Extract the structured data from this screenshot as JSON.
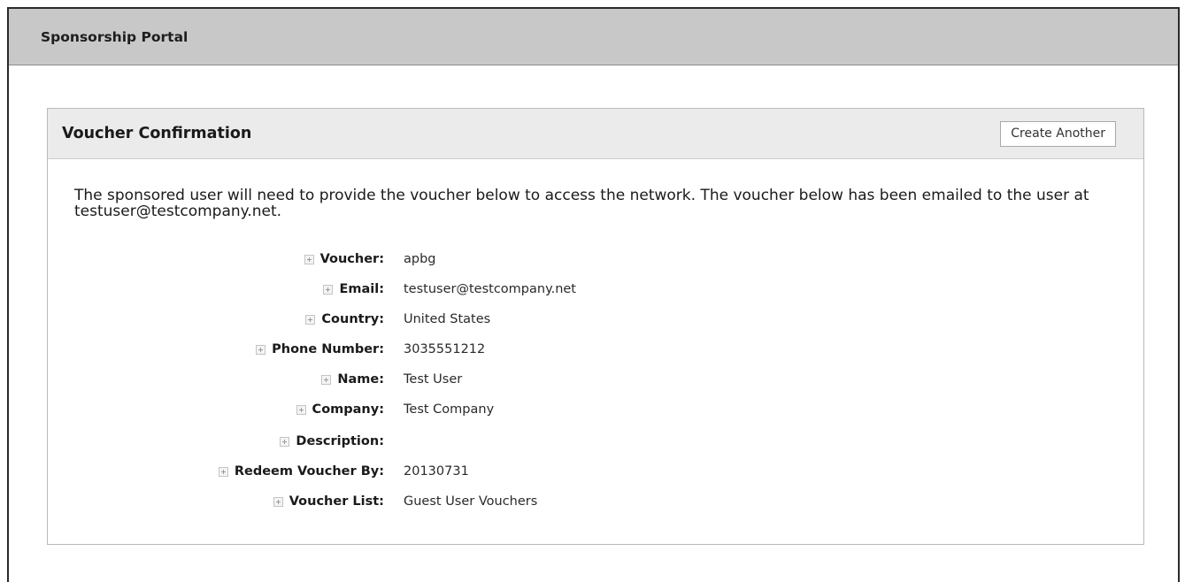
{
  "header": {
    "title": "Sponsorship Portal"
  },
  "panel": {
    "title": "Voucher Confirmation",
    "create_button_label": "Create Another",
    "intro_text": "The sponsored user will need to provide the voucher below to access the network. The voucher below has been emailed to the user at testuser@testcompany.net."
  },
  "fields": [
    {
      "label": "Voucher:",
      "value": "apbg"
    },
    {
      "label": "Email:",
      "value": "testuser@testcompany.net"
    },
    {
      "label": "Country:",
      "value": "United States"
    },
    {
      "label": "Phone Number:",
      "value": "3035551212"
    },
    {
      "label": "Name:",
      "value": "Test User"
    },
    {
      "label": "Company:",
      "value": "Test Company"
    },
    {
      "label": "Description:",
      "value": ""
    },
    {
      "label": "Redeem Voucher By:",
      "value": "20130731"
    },
    {
      "label": "Voucher List:",
      "value": "Guest User Vouchers"
    }
  ],
  "icons": {
    "expand": "expand-icon"
  },
  "colors": {
    "titlebar_bg": "#c8c8c8",
    "panel_header_bg": "#ebebeb",
    "border": "#2a2a2a"
  }
}
